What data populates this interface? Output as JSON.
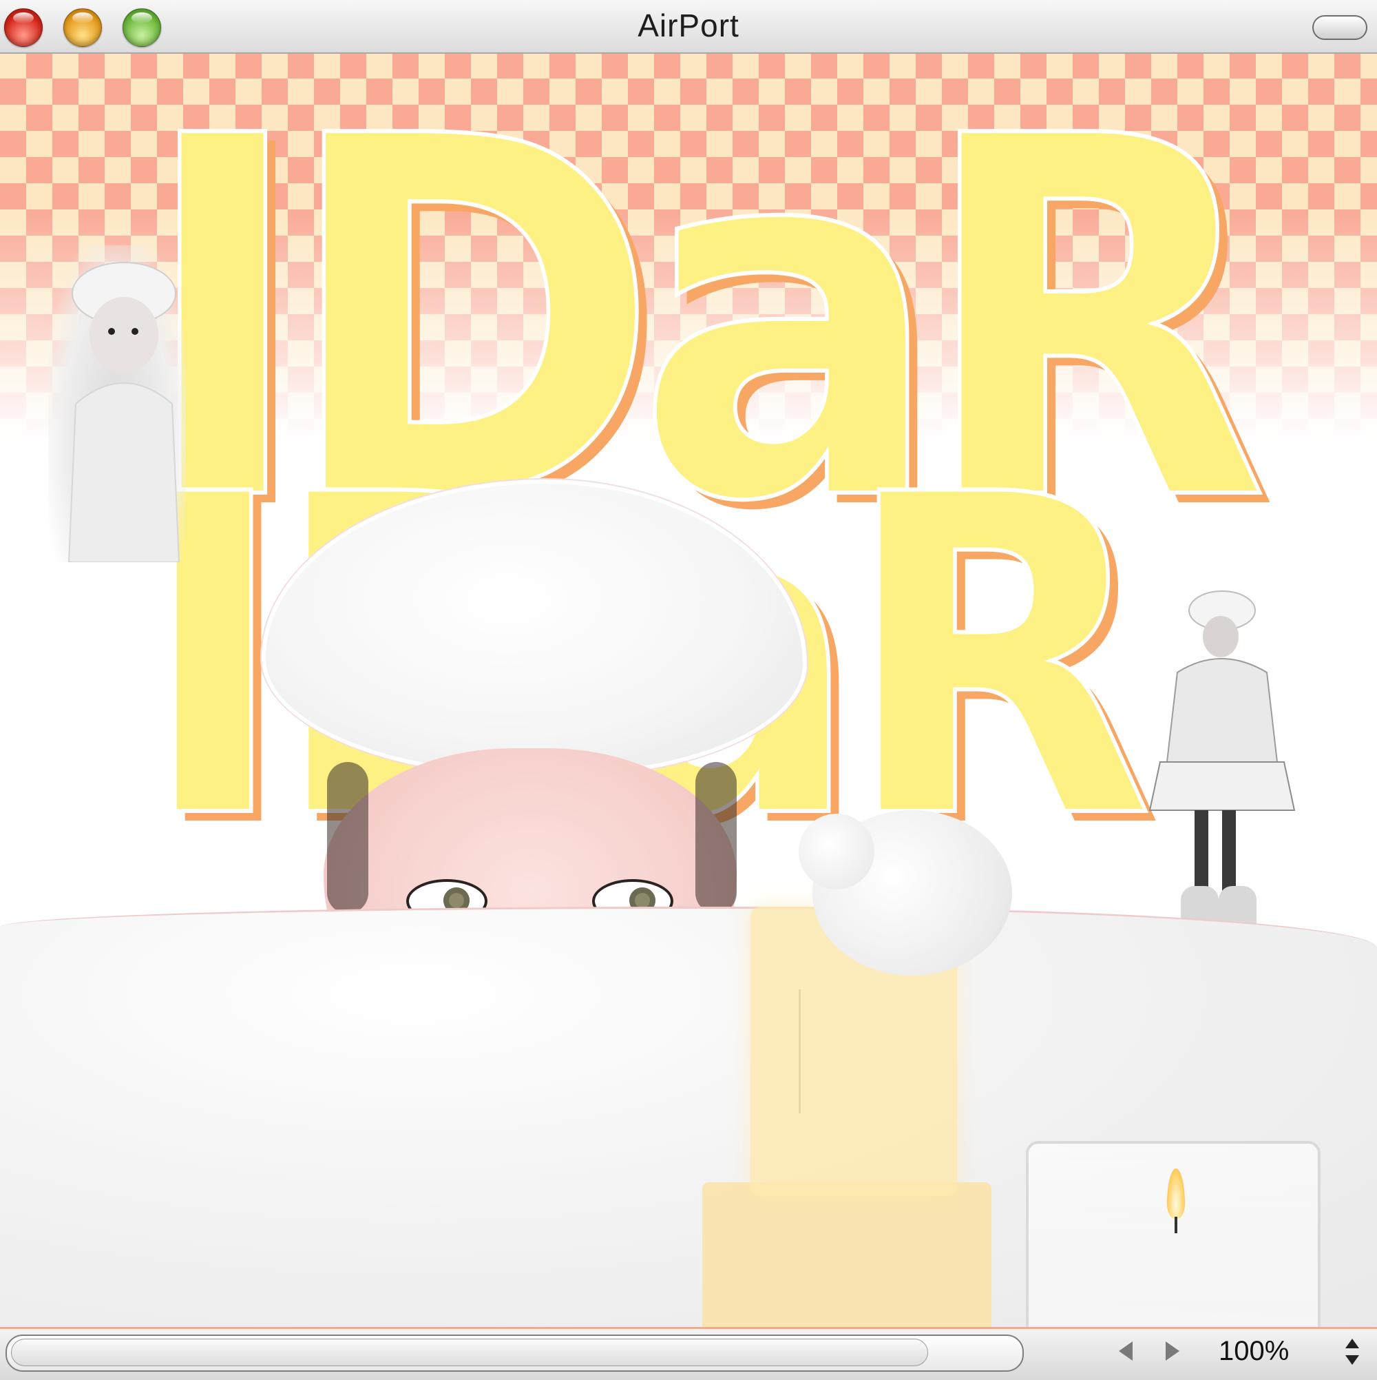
{
  "window": {
    "title": "AirPort",
    "buttons": [
      "close-button",
      "minimize-button",
      "zoom-button"
    ]
  },
  "artwork": {
    "headline": "IDaR",
    "colors": {
      "checker_primary": "#f9a994",
      "checker_secondary": "#fde7c2",
      "letter_fill": "#fdf184",
      "letter_shadow": "#f7a763"
    }
  },
  "statusbar": {
    "zoom_label": "100%"
  }
}
